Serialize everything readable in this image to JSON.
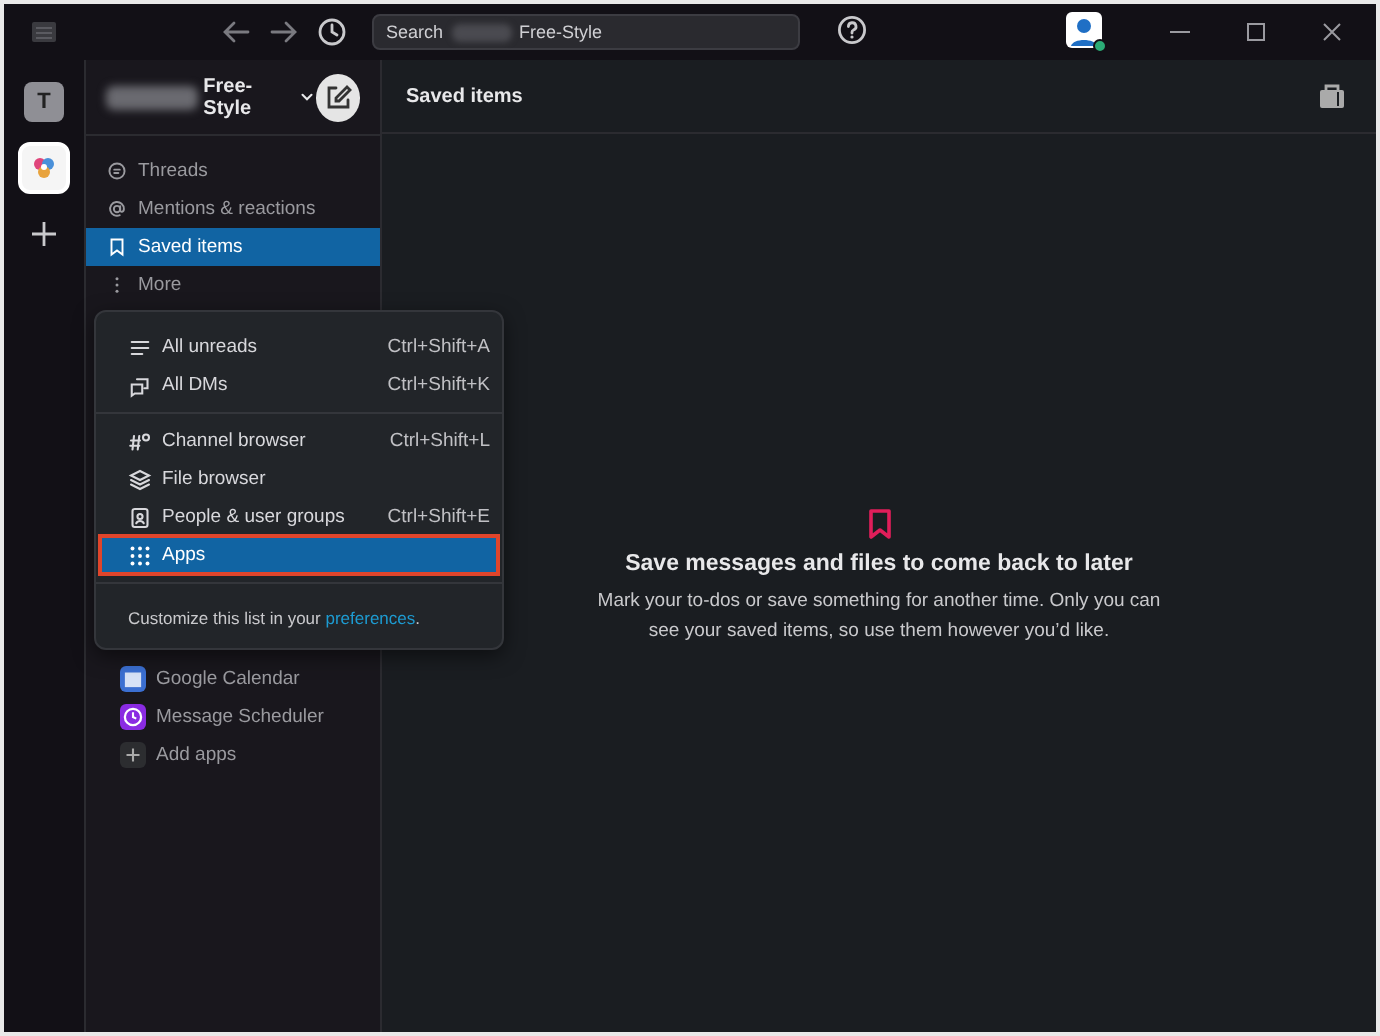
{
  "titlebar": {
    "search": {
      "prefix": "Search",
      "workspace": "Free-Style"
    }
  },
  "workspace": {
    "name": "Free-Style",
    "rail_initial": "T"
  },
  "sidebar": {
    "items": [
      {
        "kind": "threads",
        "label": "Threads",
        "selected": false
      },
      {
        "kind": "mentions",
        "label": "Mentions & reactions",
        "selected": false
      },
      {
        "kind": "saved",
        "label": "Saved items",
        "selected": true
      },
      {
        "kind": "more",
        "label": "More",
        "selected": false
      }
    ],
    "apps": [
      {
        "kind": "calendar",
        "label": "Google Calendar",
        "color": "#3b6fd1"
      },
      {
        "kind": "scheduler",
        "label": "Message Scheduler",
        "color": "#8a2be2"
      },
      {
        "kind": "add",
        "label": "Add apps",
        "color": "#2c2d30"
      }
    ]
  },
  "more_menu": {
    "groups": [
      [
        {
          "kind": "unreads",
          "label": "All unreads",
          "shortcut": "Ctrl+Shift+A",
          "selected": false
        },
        {
          "kind": "dms",
          "label": "All DMs",
          "shortcut": "Ctrl+Shift+K",
          "selected": false
        }
      ],
      [
        {
          "kind": "channels",
          "label": "Channel browser",
          "shortcut": "Ctrl+Shift+L",
          "selected": false
        },
        {
          "kind": "files",
          "label": "File browser",
          "selected": false
        },
        {
          "kind": "people",
          "label": "People & user groups",
          "shortcut": "Ctrl+Shift+E",
          "selected": false
        },
        {
          "kind": "apps",
          "label": "Apps",
          "selected": true
        }
      ]
    ],
    "footer": {
      "text": "Customize this list in your ",
      "link": "preferences",
      "end": "."
    }
  },
  "main": {
    "title": "Saved items",
    "empty": {
      "heading": "Save messages and files to come back to later",
      "body": "Mark your to-dos or save something for another time. Only you can see your saved items, so use them however you’d like."
    }
  }
}
